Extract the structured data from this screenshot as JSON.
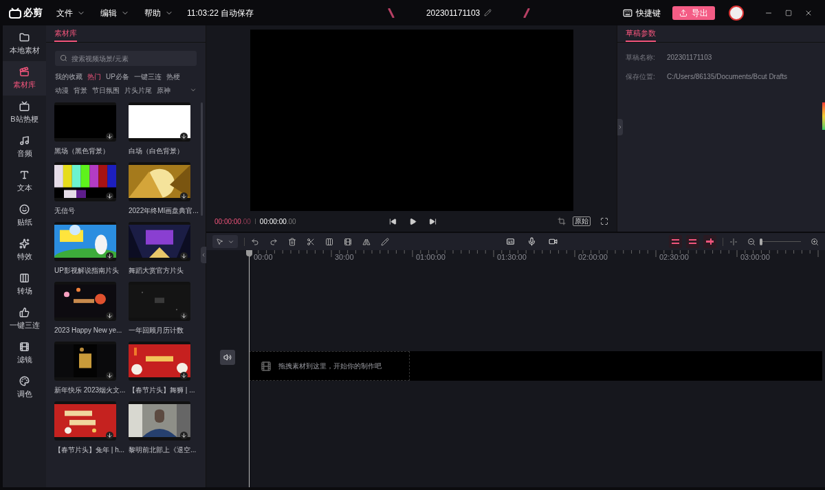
{
  "app": {
    "name": "必剪"
  },
  "menu": [
    {
      "label": "文件"
    },
    {
      "label": "编辑"
    },
    {
      "label": "帮助"
    }
  ],
  "autosave": "11:03:22 自动保存",
  "project_title": "202301171103",
  "shortcuts": "快捷键",
  "export": "导出",
  "sidebar": [
    {
      "label": "本地素材",
      "selected": false
    },
    {
      "label": "素材库",
      "selected": true
    },
    {
      "label": "B站热梗",
      "selected": false
    },
    {
      "label": "音频",
      "selected": false
    },
    {
      "label": "文本",
      "selected": false
    },
    {
      "label": "贴纸",
      "selected": false
    },
    {
      "label": "特效",
      "selected": false
    },
    {
      "label": "转场",
      "selected": false
    },
    {
      "label": "一键三连",
      "selected": false
    },
    {
      "label": "滤镜",
      "selected": false
    },
    {
      "label": "调色",
      "selected": false
    }
  ],
  "library": {
    "tab": "素材库",
    "search_placeholder": "搜索视频场景/元素",
    "categories": [
      {
        "label": "我的收藏",
        "selected": false
      },
      {
        "label": "热门",
        "selected": true
      },
      {
        "label": "UP必备",
        "selected": false
      },
      {
        "label": "一键三连",
        "selected": false
      },
      {
        "label": "热梗",
        "selected": false
      },
      {
        "label": "动漫",
        "selected": false
      },
      {
        "label": "背景",
        "selected": false
      },
      {
        "label": "节日氛围",
        "selected": false
      },
      {
        "label": "片头片尾",
        "selected": false
      },
      {
        "label": "原神",
        "selected": false
      }
    ],
    "items": [
      {
        "title": "黑场（黑色背景）"
      },
      {
        "title": "白场（白色背景）"
      },
      {
        "title": "无信号"
      },
      {
        "title": "2022年终MI画盘典官..."
      },
      {
        "title": "UP影视解说指南片头"
      },
      {
        "title": "舞蹈大赏官方片头"
      },
      {
        "title": "2023 Happy New ye..."
      },
      {
        "title": "一年回顾月历计数"
      },
      {
        "title": "新年快乐 2023烟火文..."
      },
      {
        "title": "【春节片头】舞狮 | ..."
      },
      {
        "title": "【春节片头】兔年 | h..."
      },
      {
        "title": "黎明前北部上《退空..."
      }
    ]
  },
  "player": {
    "current": "00:00:00",
    "current_frac": ".00",
    "total": "00:00:00",
    "total_frac": ".00",
    "ratio": "原始"
  },
  "draft": {
    "tab": "草稿参数",
    "fields": [
      {
        "label": "草稿名称:",
        "value": "202301171103"
      },
      {
        "label": "保存位置:",
        "value": "C:/Users/86135/Documents/Bcut Drafts"
      }
    ]
  },
  "timeline": {
    "ruler": [
      "00:00",
      "30:00",
      "01:00:00",
      "01:30:00",
      "02:00:00",
      "02:30:00",
      "03:00:00"
    ],
    "zoom": {
      "level": 0.02
    },
    "drop_hint": "拖拽素材到这里，开始你的制作吧"
  }
}
